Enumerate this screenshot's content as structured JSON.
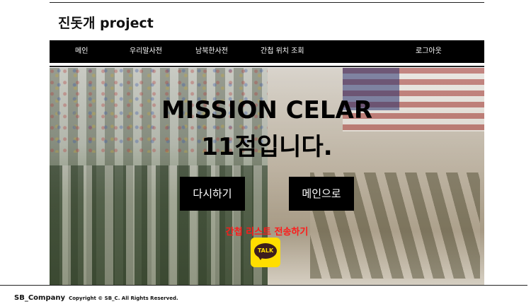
{
  "header": {
    "site_title": "진돗개 project"
  },
  "nav": {
    "items": [
      {
        "label": "메인"
      },
      {
        "label": "우리말사전"
      },
      {
        "label": "남북한사전"
      },
      {
        "label": "간첩 위치 조회"
      }
    ],
    "logout_label": "로그아웃"
  },
  "result": {
    "line1": "MISSION CELAR",
    "line2": "11점입니다.",
    "retry_label": "다시하기",
    "main_label": "메인으로",
    "send_label": "간첩 리스트 전송하기",
    "kakao_text": "TALK"
  },
  "footer": {
    "brand": "SB_Company",
    "copyright": "Copyright © SB_C. All Rights Reserved."
  },
  "colors": {
    "navbar": "#000000",
    "send_link": "#ff1a1a",
    "kakao": "#ffde00"
  }
}
